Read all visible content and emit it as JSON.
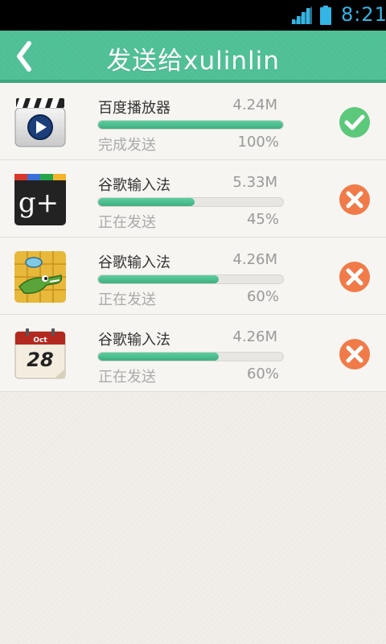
{
  "status_bar": {
    "time": "8:21"
  },
  "header": {
    "title": "发送给xulinlin"
  },
  "colors": {
    "accent": "#4fbf95",
    "done": "#5cc97a",
    "cancel": "#f07b48"
  },
  "transfers": [
    {
      "name": "百度播放器",
      "size": "4.24M",
      "status": "完成发送",
      "percent_label": "100%",
      "progress": 1.0,
      "icon": "video-player-icon",
      "action": "check-icon"
    },
    {
      "name": "谷歌输入法",
      "size": "5.33M",
      "status": "正在发送",
      "percent_label": "45%",
      "progress": 0.52,
      "icon": "google-plus-icon",
      "action": "cancel-icon"
    },
    {
      "name": "谷歌输入法",
      "size": "4.26M",
      "status": "正在发送",
      "percent_label": "60%",
      "progress": 0.65,
      "icon": "crocodile-game-icon",
      "action": "cancel-icon"
    },
    {
      "name": "谷歌输入法",
      "size": "4.26M",
      "status": "正在发送",
      "percent_label": "60%",
      "progress": 0.65,
      "icon": "calendar-icon",
      "action": "cancel-icon"
    }
  ],
  "icon_text": {
    "gplus": "g+",
    "cal_month": "Oct",
    "cal_day": "28"
  }
}
